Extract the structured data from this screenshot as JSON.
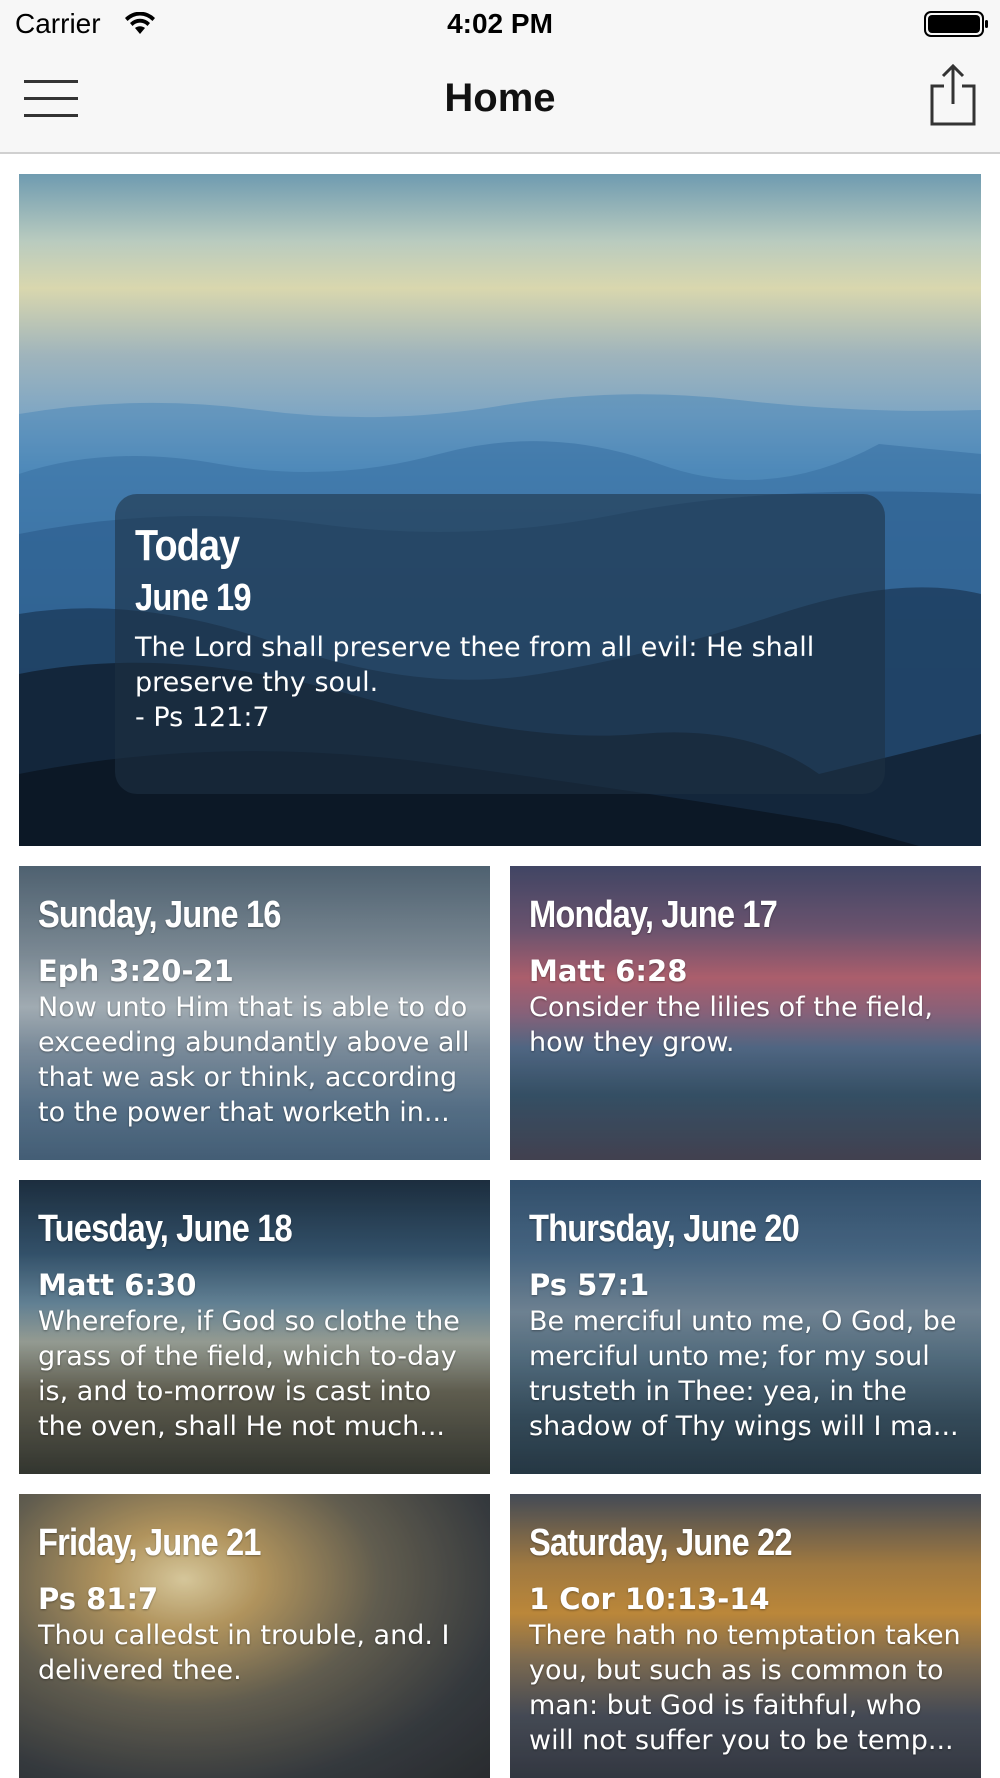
{
  "status_bar": {
    "carrier": "Carrier",
    "time": "4:02 PM"
  },
  "nav": {
    "title": "Home",
    "menu_icon": "hamburger-menu-icon",
    "share_icon": "share-icon"
  },
  "today": {
    "label": "Today",
    "date": "June 19",
    "verse": "The Lord shall preserve thee from all evil: He shall preserve thy soul.\n- Ps 121:7"
  },
  "cards": [
    {
      "day": "Sunday, June 16",
      "reference": "Eph 3:20-21",
      "text": "Now unto Him that is able to do exceeding abundantly above all that we ask or think, according to the power that worketh in..."
    },
    {
      "day": "Monday, June 17",
      "reference": "Matt 6:28",
      "text": "Consider the lilies of the field, how they grow."
    },
    {
      "day": "Tuesday, June 18",
      "reference": "Matt 6:30",
      "text": "Wherefore, if God so clothe the grass of the field, which to-day is, and to-morrow is cast into the oven, shall He not much..."
    },
    {
      "day": "Thursday, June 20",
      "reference": "Ps 57:1",
      "text": "Be merciful unto me, O God, be merciful unto me; for my soul trusteth in Thee: yea, in the shadow of Thy wings will I ma..."
    },
    {
      "day": "Friday, June 21",
      "reference": "Ps 81:7",
      "text": "Thou calledst in trouble, and. I delivered thee."
    },
    {
      "day": "Saturday, June 22",
      "reference": "1 Cor 10:13-14",
      "text": "There hath no temptation taken you, but such as is common to man: but God is faithful, who will not suffer you to be temp..."
    }
  ]
}
